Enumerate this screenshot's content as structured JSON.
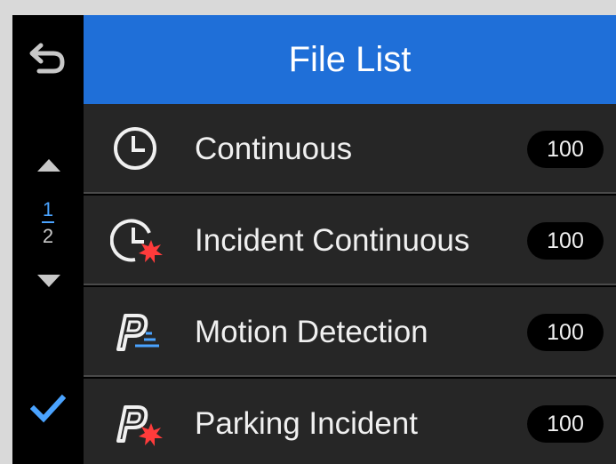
{
  "header": {
    "title": "File List"
  },
  "sidebar": {
    "back_icon": "back-return-icon",
    "page_up_icon": "triangle-up-icon",
    "page_down_icon": "triangle-down-icon",
    "page_current": "1",
    "page_total": "2",
    "confirm_icon": "checkmark-icon"
  },
  "list": {
    "items": [
      {
        "label": "Continuous",
        "count": "100",
        "icon": "clock-icon"
      },
      {
        "label": "Incident Continuous",
        "count": "100",
        "icon": "clock-incident-icon"
      },
      {
        "label": "Motion Detection",
        "count": "100",
        "icon": "parking-motion-icon"
      },
      {
        "label": "Parking Incident",
        "count": "100",
        "icon": "parking-incident-icon"
      }
    ]
  },
  "colors": {
    "header_bg": "#1f6fd8",
    "accent": "#4aa3ff",
    "incident_red": "#ff3b3b",
    "row_bg": "#262626",
    "sidebar_bg": "#000000"
  }
}
